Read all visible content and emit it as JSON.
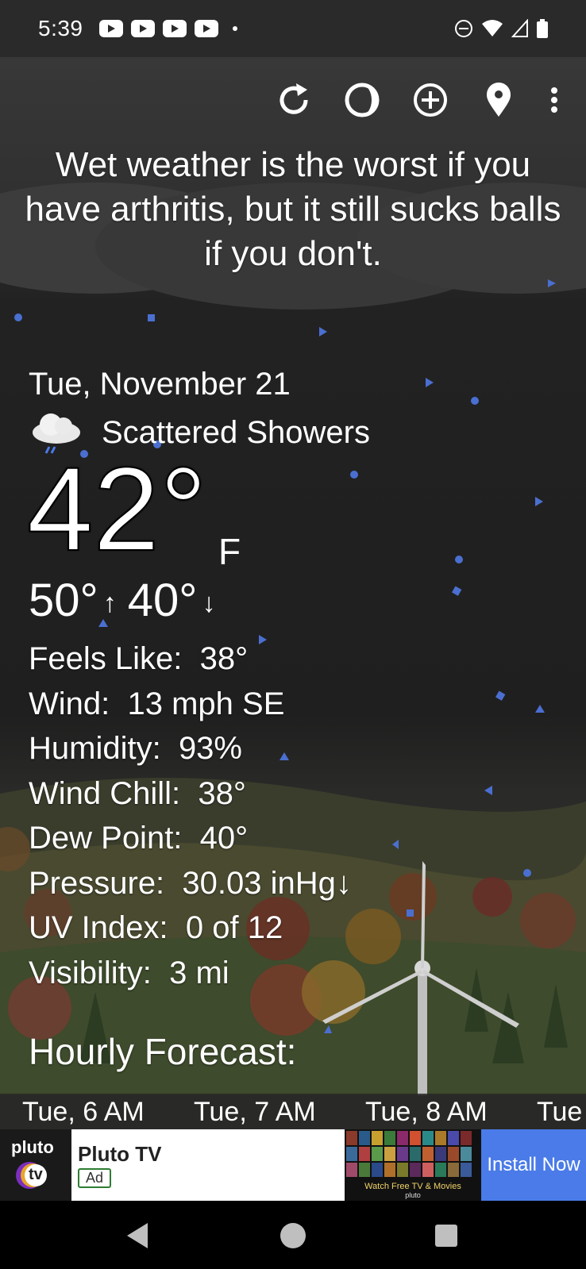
{
  "status_bar": {
    "time": "5:39",
    "notification_icons": [
      "youtube-icon",
      "youtube-icon",
      "youtube-icon",
      "youtube-icon"
    ],
    "right_icons": [
      "do-not-disturb-icon",
      "wifi-icon",
      "signal-icon",
      "battery-icon"
    ]
  },
  "toolbar": {
    "icons": [
      "refresh-icon",
      "theme-icon",
      "add-location-icon",
      "location-pin-icon",
      "more-vert-icon"
    ]
  },
  "quote": "Wet weather is the worst if you have arthritis, but it still sucks balls if you don't.",
  "weather": {
    "date": "Tue, November 21",
    "condition_icon": "rain-cloud-icon",
    "condition": "Scattered Showers",
    "temperature": "42°",
    "unit": "F",
    "high": "50°",
    "low": "40°",
    "details": [
      {
        "label": "Feels Like:",
        "value": "38°"
      },
      {
        "label": "Wind:",
        "value": "13 mph SE"
      },
      {
        "label": "Humidity:",
        "value": "93%"
      },
      {
        "label": "Wind Chill:",
        "value": "38°"
      },
      {
        "label": "Dew Point:",
        "value": "40°"
      },
      {
        "label": "Pressure:",
        "value": "30.03 inHg↓"
      },
      {
        "label": "UV Index:",
        "value": "0 of 12"
      },
      {
        "label": "Visibility:",
        "value": "3 mi"
      }
    ]
  },
  "hourly": {
    "title": "Hourly Forecast:",
    "labels": [
      "Tue, 6 AM",
      "Tue, 7 AM",
      "Tue, 8 AM",
      "Tue"
    ]
  },
  "ad": {
    "logo_text": "pluto",
    "logo_sub": "tv",
    "title": "Pluto TV",
    "badge": "Ad",
    "image_caption": "Watch Free TV & Movies",
    "image_sub": "pluto",
    "cta": "Install Now"
  },
  "colors": {
    "accent_blue": "#4a7be8",
    "rain_particles": "#4a6fd1"
  }
}
